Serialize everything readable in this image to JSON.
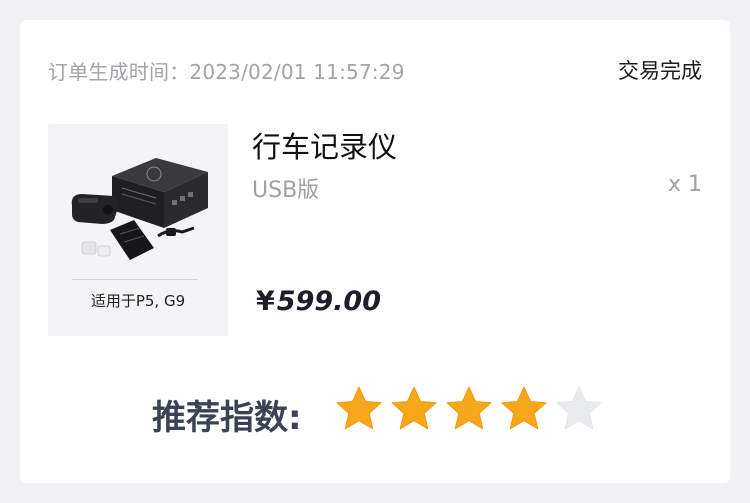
{
  "order": {
    "meta_label": "订单生成时间：",
    "created_at": "2023/02/01 11:57:29",
    "status": "交易完成"
  },
  "product": {
    "name": "行车记录仪",
    "variant": "USB版",
    "quantity": "x 1",
    "price_currency": "¥",
    "price_amount": "599.00",
    "image_caption": "适用于P5, G9"
  },
  "rating": {
    "label": "推荐指数:",
    "value": 4,
    "max": 5,
    "colors": {
      "filled": "#F7A81A",
      "empty": "#E9ECEF"
    }
  }
}
